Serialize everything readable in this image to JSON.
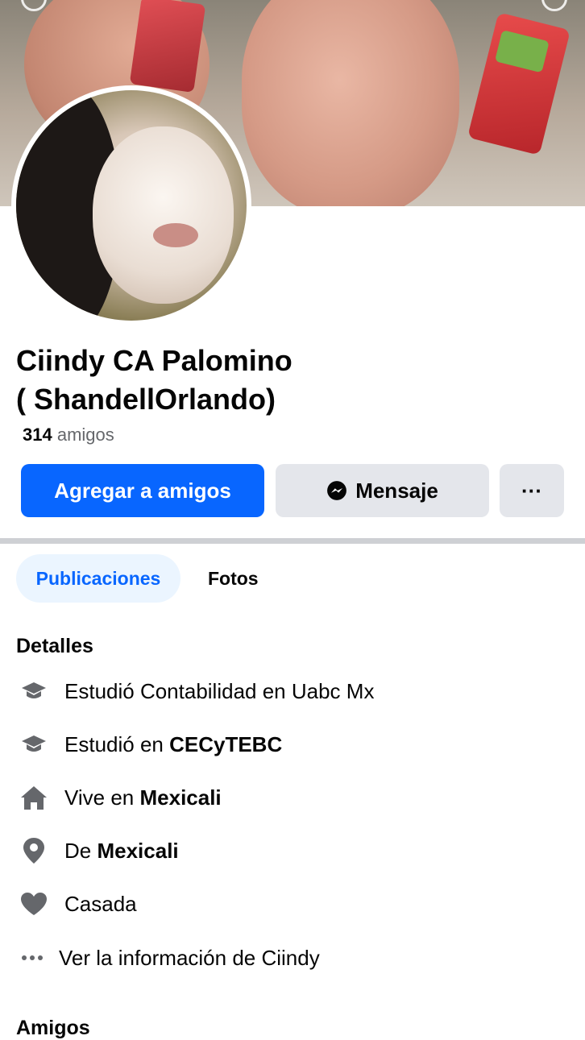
{
  "profile": {
    "name_line1": "Ciindy CA Palomino",
    "name_line2": "( ShandellOrlando)",
    "friends_count": "314",
    "friends_label": "amigos"
  },
  "actions": {
    "add_friend": "Agregar a amigos",
    "message": "Mensaje",
    "more": "···"
  },
  "tabs": [
    {
      "label": "Publicaciones",
      "active": true
    },
    {
      "label": "Fotos",
      "active": false
    }
  ],
  "details": {
    "title": "Detalles",
    "items": [
      {
        "icon": "graduation-cap-icon",
        "prefix": "Estudió Contabilidad en Uabc Mx",
        "bold": ""
      },
      {
        "icon": "graduation-cap-icon",
        "prefix": "Estudió en ",
        "bold": "CECyTEBC"
      },
      {
        "icon": "home-icon",
        "prefix": "Vive en ",
        "bold": "Mexicali"
      },
      {
        "icon": "location-pin-icon",
        "prefix": "De ",
        "bold": "Mexicali"
      },
      {
        "icon": "heart-icon",
        "prefix": "Casada",
        "bold": ""
      }
    ],
    "see_more": "Ver la información de Ciindy"
  },
  "next_section": {
    "title": "Amigos"
  },
  "colors": {
    "primary": "#0866ff",
    "secondary_button": "#e4e6eb",
    "active_tab_bg": "#ebf5ff",
    "muted_text": "#65676b",
    "icon": "#65676b"
  }
}
